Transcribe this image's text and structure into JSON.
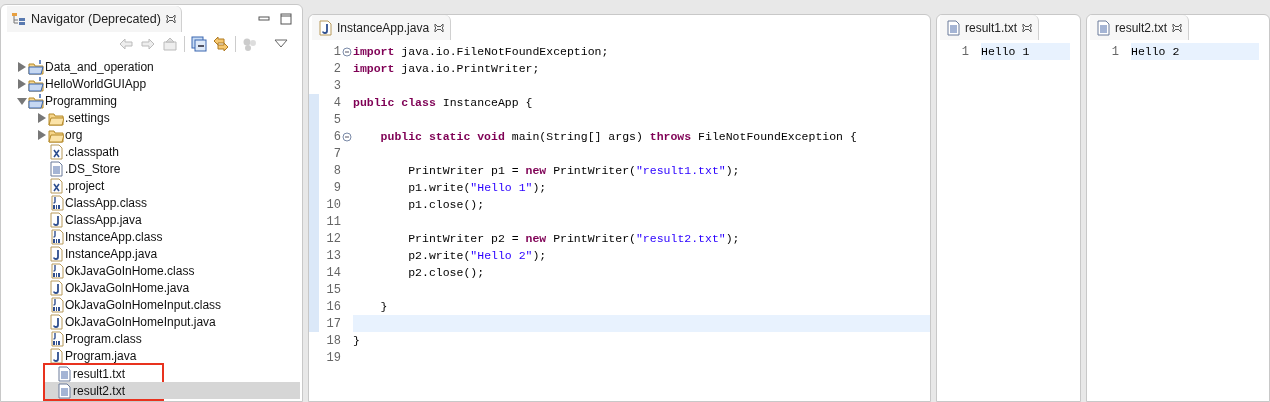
{
  "navigator": {
    "title": "Navigator (Deprecated)",
    "tree": [
      {
        "label": "Data_and_operation",
        "kind": "project",
        "expanded": false
      },
      {
        "label": "HelloWorldGUIApp",
        "kind": "project",
        "expanded": false
      },
      {
        "label": "Programming",
        "kind": "project",
        "expanded": true,
        "children": [
          {
            "label": ".settings",
            "kind": "folder",
            "expanded": false
          },
          {
            "label": "org",
            "kind": "folder",
            "expanded": false
          },
          {
            "label": ".classpath",
            "kind": "xml"
          },
          {
            "label": ".DS_Store",
            "kind": "text"
          },
          {
            "label": ".project",
            "kind": "xml"
          },
          {
            "label": "ClassApp.class",
            "kind": "class"
          },
          {
            "label": "ClassApp.java",
            "kind": "java"
          },
          {
            "label": "InstanceApp.class",
            "kind": "class"
          },
          {
            "label": "InstanceApp.java",
            "kind": "java"
          },
          {
            "label": "OkJavaGoInHome.class",
            "kind": "class"
          },
          {
            "label": "OkJavaGoInHome.java",
            "kind": "java"
          },
          {
            "label": "OkJavaGoInHomeInput.class",
            "kind": "class"
          },
          {
            "label": "OkJavaGoInHomeInput.java",
            "kind": "java"
          },
          {
            "label": "Program.class",
            "kind": "class"
          },
          {
            "label": "Program.java",
            "kind": "java"
          },
          {
            "label": "result1.txt",
            "kind": "text",
            "highlighted": true,
            "selected": false
          },
          {
            "label": "result2.txt",
            "kind": "text",
            "highlighted": true,
            "selected": true
          }
        ]
      }
    ]
  },
  "editors": [
    {
      "tab": "InstanceApp.java",
      "kind": "java",
      "lines": [
        {
          "n": "1",
          "fold": true,
          "segments": [
            {
              "kind": "keyword",
              "text": "import"
            },
            {
              "kind": "plain",
              "text": " java.io.FileNotFoundException;"
            }
          ]
        },
        {
          "n": "2",
          "segments": [
            {
              "kind": "keyword",
              "text": "import"
            },
            {
              "kind": "plain",
              "text": " java.io.PrintWriter;"
            }
          ]
        },
        {
          "n": "3"
        },
        {
          "n": "4",
          "changed": true,
          "segments": [
            {
              "kind": "keyword",
              "text": "public class"
            },
            {
              "kind": "plain",
              "text": " InstanceApp {"
            }
          ]
        },
        {
          "n": "5",
          "changed": true
        },
        {
          "n": "6",
          "changed": true,
          "fold": true,
          "segments": [
            {
              "kind": "keyword",
              "text": "    public static void"
            },
            {
              "kind": "plain",
              "text": " main(String[] args) "
            },
            {
              "kind": "keyword",
              "text": "throws"
            },
            {
              "kind": "plain",
              "text": " FileNotFoundException {"
            }
          ]
        },
        {
          "n": "7",
          "changed": true
        },
        {
          "n": "8",
          "changed": true,
          "segments": [
            {
              "kind": "plain",
              "text": "        PrintWriter p1 = "
            },
            {
              "kind": "keyword",
              "text": "new"
            },
            {
              "kind": "plain",
              "text": " PrintWriter("
            },
            {
              "kind": "string",
              "text": "\"result1.txt\""
            },
            {
              "kind": "plain",
              "text": ");"
            }
          ]
        },
        {
          "n": "9",
          "changed": true,
          "segments": [
            {
              "kind": "plain",
              "text": "        p1.write("
            },
            {
              "kind": "string",
              "text": "\"Hello 1\""
            },
            {
              "kind": "plain",
              "text": ");"
            }
          ]
        },
        {
          "n": "10",
          "changed": true,
          "segments": [
            {
              "kind": "plain",
              "text": "        p1.close();"
            }
          ]
        },
        {
          "n": "11",
          "changed": true
        },
        {
          "n": "12",
          "changed": true,
          "segments": [
            {
              "kind": "plain",
              "text": "        PrintWriter p2 = "
            },
            {
              "kind": "keyword",
              "text": "new"
            },
            {
              "kind": "plain",
              "text": " PrintWriter("
            },
            {
              "kind": "string",
              "text": "\"result2.txt\""
            },
            {
              "kind": "plain",
              "text": ");"
            }
          ]
        },
        {
          "n": "13",
          "changed": true,
          "segments": [
            {
              "kind": "plain",
              "text": "        p2.write("
            },
            {
              "kind": "string",
              "text": "\"Hello 2\""
            },
            {
              "kind": "plain",
              "text": ");"
            }
          ]
        },
        {
          "n": "14",
          "changed": true,
          "segments": [
            {
              "kind": "plain",
              "text": "        p2.close();"
            }
          ]
        },
        {
          "n": "15",
          "changed": true
        },
        {
          "n": "16",
          "changed": true,
          "segments": [
            {
              "kind": "plain",
              "text": "    }"
            }
          ]
        },
        {
          "n": "17",
          "changed": true,
          "current": true
        },
        {
          "n": "18",
          "segments": [
            {
              "kind": "plain",
              "text": "}"
            }
          ]
        },
        {
          "n": "19"
        }
      ]
    },
    {
      "tab": "result1.txt",
      "kind": "text",
      "lines": [
        {
          "n": "1",
          "current": true,
          "segments": [
            {
              "kind": "plain",
              "text": "Hello 1"
            }
          ]
        }
      ]
    },
    {
      "tab": "result2.txt",
      "kind": "text",
      "lines": [
        {
          "n": "1",
          "current": true,
          "segments": [
            {
              "kind": "plain",
              "text": "Hello 2"
            }
          ]
        }
      ]
    }
  ]
}
